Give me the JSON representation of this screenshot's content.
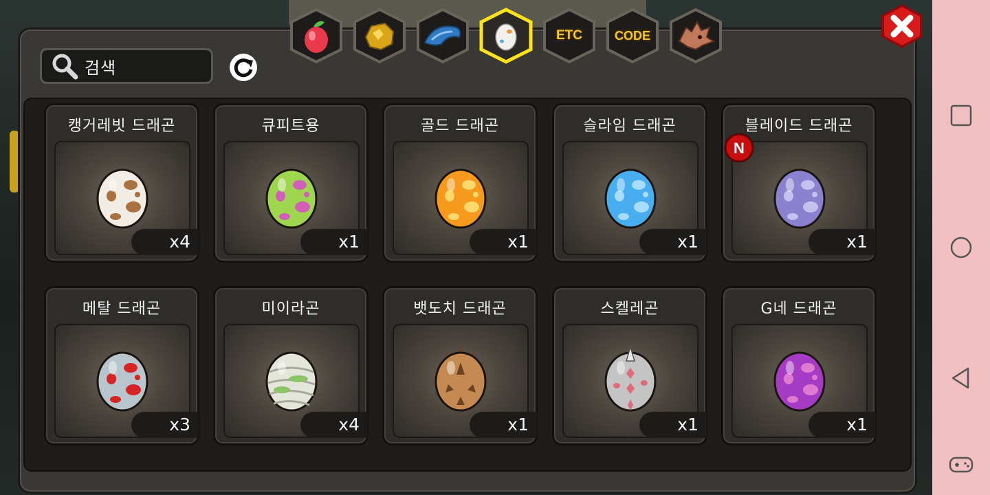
{
  "search": {
    "placeholder": "검색"
  },
  "tabs": [
    {
      "id": "fruit",
      "icon": "fruit-icon",
      "label": "",
      "selected": false
    },
    {
      "id": "gold",
      "icon": "gold-ore-icon",
      "label": "",
      "selected": false
    },
    {
      "id": "scale",
      "icon": "scale-icon",
      "label": "",
      "selected": false
    },
    {
      "id": "egg",
      "icon": "egg-icon",
      "label": "",
      "selected": true
    },
    {
      "id": "etc",
      "icon": "etc-icon",
      "label": "ETC",
      "selected": false
    },
    {
      "id": "code",
      "icon": "code-icon",
      "label": "CODE",
      "selected": false
    },
    {
      "id": "dragon",
      "icon": "dragon-head-icon",
      "label": "",
      "selected": false
    }
  ],
  "items": [
    {
      "name": "캥거레빗 드래곤",
      "count": "x4",
      "egg": {
        "base": "#f1ece4",
        "spot": "#a8713f",
        "style": "spots"
      },
      "is_new": false
    },
    {
      "name": "큐피트용",
      "count": "x1",
      "egg": {
        "base": "#9ed650",
        "spot": "#d25fb8",
        "style": "spots"
      },
      "is_new": false
    },
    {
      "name": "골드 드래곤",
      "count": "x1",
      "egg": {
        "base": "#f59a1c",
        "spot": "#ffd86b",
        "style": "spots"
      },
      "is_new": false
    },
    {
      "name": "슬라임 드래곤",
      "count": "x1",
      "egg": {
        "base": "#48aef0",
        "spot": "#a8dcff",
        "style": "spots"
      },
      "is_new": false
    },
    {
      "name": "블레이드 드래곤",
      "count": "x1",
      "egg": {
        "base": "#8a82cf",
        "spot": "#c6c0ee",
        "style": "spots"
      },
      "is_new": true,
      "new_label": "N"
    },
    {
      "name": "메탈 드래곤",
      "count": "x3",
      "egg": {
        "base": "#b9c5cc",
        "spot": "#d62424",
        "style": "spots"
      },
      "is_new": false
    },
    {
      "name": "미이라곤",
      "count": "x4",
      "egg": {
        "base": "#e4e6dc",
        "spot": "#8cc46a",
        "style": "bandage"
      },
      "is_new": false
    },
    {
      "name": "뱃도치 드래곤",
      "count": "x1",
      "egg": {
        "base": "#c48a52",
        "spot": "#6b4222",
        "style": "spiky"
      },
      "is_new": false
    },
    {
      "name": "스켈레곤",
      "count": "x1",
      "egg": {
        "base": "#c4c4c4",
        "spot": "#e06b78",
        "style": "bone"
      },
      "is_new": false
    },
    {
      "name": "G네 드래곤",
      "count": "x1",
      "egg": {
        "base": "#a63bc4",
        "spot": "#e07ad0",
        "style": "spots"
      },
      "is_new": false
    }
  ],
  "colors": {
    "accent": "#f3c62d",
    "close_button": "#d81a1a",
    "panel": "#3a3835",
    "nav_bar": "#f2c0c0"
  }
}
